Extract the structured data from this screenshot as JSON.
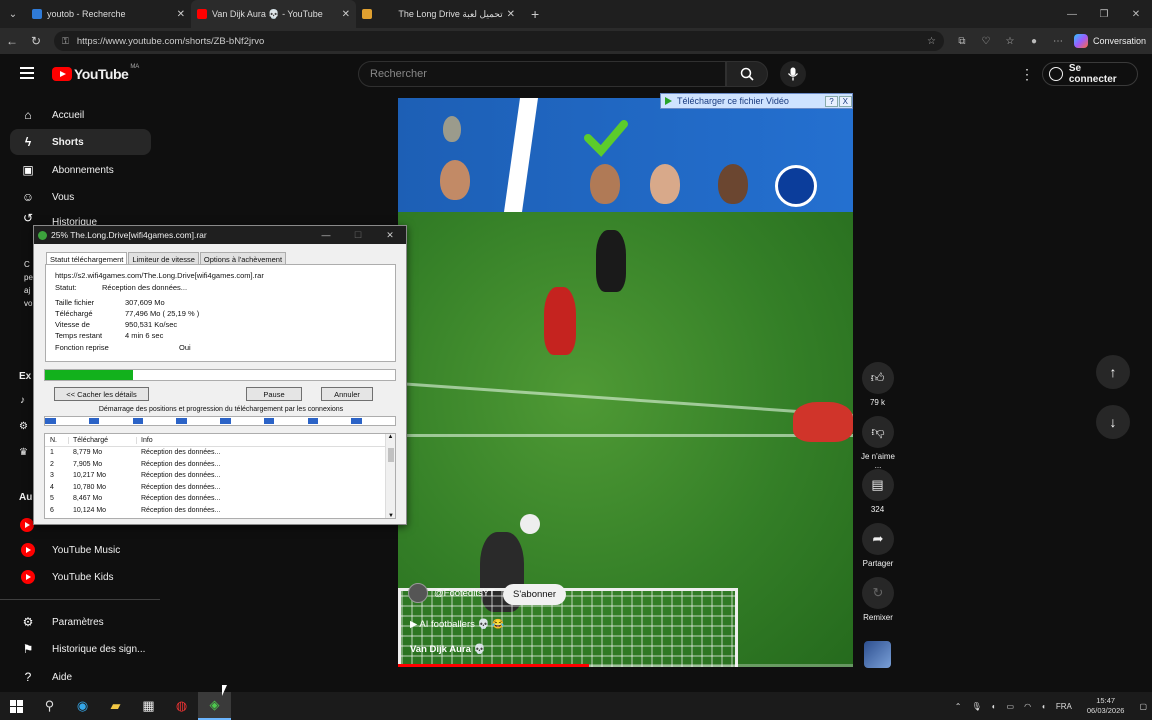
{
  "browser": {
    "tabs": [
      {
        "label": "youtob - Recherche",
        "favicon_color": "#2f7bd8"
      },
      {
        "label": "Van Dijk Aura 💀 - YouTube",
        "favicon_color": "#ff0000"
      },
      {
        "label": "The Long Drive تحميل لعبة",
        "favicon_color": "#e0a030"
      }
    ],
    "url": "https://www.youtube.com/shorts/ZB-bNf2jrvo",
    "copilot_label": "Conversation"
  },
  "youtube": {
    "logo_text": "YouTube",
    "logo_country": "MA",
    "search_placeholder": "Rechercher",
    "signin_label": "Se connecter",
    "sidebar": {
      "home": "Accueil",
      "shorts": "Shorts",
      "subscriptions": "Abonnements",
      "you": "Vous",
      "history": "Historique",
      "explore_fragment": "Ex",
      "more_fragment": "Au",
      "notice_fragments": [
        "C",
        "pe",
        "aj",
        "vo"
      ],
      "music": "YouTube Music",
      "kids": "YouTube Kids",
      "settings": "Paramètres",
      "report_history": "Historique des sign...",
      "help": "Aide"
    },
    "short": {
      "channel": "@FooteditsYT",
      "subscribe": "S'abonner",
      "title_link": "AI footballers 💀 😂",
      "title": "Van Dijk Aura 💀",
      "progress": 0.42
    },
    "actions": {
      "likes": "79 k",
      "dislike": "Je n'aime ...",
      "comments": "324",
      "share": "Partager",
      "remix": "Remixer"
    }
  },
  "download_overlay": {
    "label": "Télécharger ce fichier Vidéo",
    "help": "?",
    "close": "X"
  },
  "idm": {
    "title": "25% The.Long.Drive[wifi4games.com].rar",
    "tabs": [
      "Statut téléchargement",
      "Limiteur de vitesse",
      "Options à l'achèvement"
    ],
    "url": "https://s2.wifi4games.com/The.Long.Drive[wifi4games.com].rar",
    "status_label": "Statut:",
    "status_value": "Réception des données...",
    "rows": [
      {
        "k": "Taille fichier",
        "v": "307,609  Mo"
      },
      {
        "k": "Téléchargé",
        "v": "77,496  Mo  ( 25,19 % )"
      },
      {
        "k": "Vitesse de",
        "v": "950,531  Ko/sec"
      },
      {
        "k": "Temps restant",
        "v": "4 min 6 sec"
      },
      {
        "k": "Fonction reprise",
        "v": "Oui"
      }
    ],
    "progress": 0.2519,
    "btn_details": "<< Cacher les détails",
    "btn_pause": "Pause",
    "btn_cancel": "Annuler",
    "segments_label": "Démarrage des positions et progression du téléchargement par les connexions",
    "table_headers": [
      "N.",
      "Téléchargé",
      "Info"
    ],
    "connections": [
      {
        "n": "1",
        "dl": "8,779  Mo",
        "info": "Réception des données..."
      },
      {
        "n": "2",
        "dl": "7,905  Mo",
        "info": "Réception des données..."
      },
      {
        "n": "3",
        "dl": "10,217  Mo",
        "info": "Réception des données..."
      },
      {
        "n": "4",
        "dl": "10,780  Mo",
        "info": "Réception des données..."
      },
      {
        "n": "5",
        "dl": "8,467  Mo",
        "info": "Réception des données..."
      },
      {
        "n": "6",
        "dl": "10,124  Mo",
        "info": "Réception des données..."
      }
    ]
  },
  "taskbar": {
    "language": "FRA",
    "time": "15:47",
    "date": "06/03/2026"
  }
}
